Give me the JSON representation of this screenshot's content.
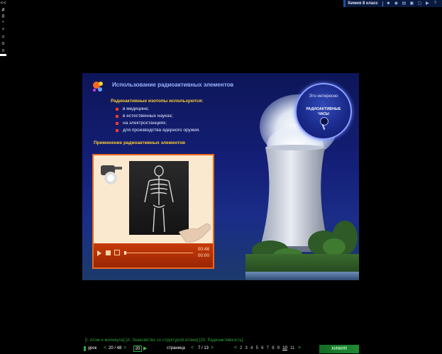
{
  "left_toolbar": {
    "items": [
      "<<",
      "#",
      "0",
      "^",
      "*",
      "=",
      "o",
      "x"
    ]
  },
  "top_toolbar": {
    "title": "Химия 8 класс",
    "icons": [
      "separator",
      "users-icon",
      "eye-icon",
      "book-icon",
      "camera-icon",
      "monitor-icon",
      "speaker-icon",
      "help-icon"
    ]
  },
  "slide": {
    "title": "Использование радиоактивных элементов",
    "subtitle": "Радиоактивные изотопы используются:",
    "bullets": [
      "в медицине;",
      "в естественных науках;",
      "на электростанциях;",
      "для производства ядерного оружия."
    ],
    "section": "Применение радиоактивных элементов",
    "info_circle": {
      "heading": "Это интересно",
      "line1": "РАДИОАКТИВНЫЕ",
      "line2": "ЧАСЫ"
    },
    "player": {
      "time_current": "00:48",
      "time_total": "00:00",
      "progress": 0.0
    }
  },
  "bottom": {
    "breadcrumb": "[I. Атом и молекула] [А. Знакомство со структурой атома] [20. Радиоактивность]",
    "lesson_label": "урок",
    "lesson_value": "20 / 48",
    "lesson_input": "20",
    "page_label": "страница",
    "page_value": "7 / 13",
    "pages": [
      "2",
      "3",
      "4",
      "5",
      "6",
      "7",
      "8",
      "9",
      "10",
      "11"
    ],
    "current_page": "10",
    "brand": "ХИМИЯ"
  },
  "colors": {
    "accent_green": "#2fa43a",
    "slide_title": "#9bb4ff",
    "highlight": "#ffcc33",
    "player_orange": "#e76a18"
  }
}
